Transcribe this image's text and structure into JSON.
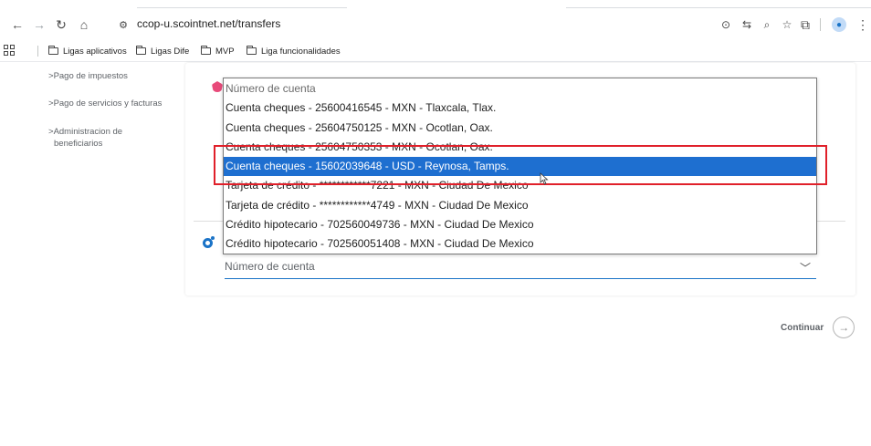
{
  "browser": {
    "url": "ccop-u.scointnet.net/transfers",
    "bookmarks": [
      "Ligas aplicativos",
      "Ligas Dife",
      "MVP",
      "Liga funcionalidades"
    ]
  },
  "sidebar": {
    "items": [
      "Pago de impuestos",
      "Pago de servicios y facturas",
      "Administracion de",
      "beneficiarios"
    ],
    "chevron": ">"
  },
  "dropdown": {
    "placeholder": "Número de cuenta",
    "options": [
      "Cuenta cheques - 25600416545 - MXN - Tlaxcala, Tlax.",
      "Cuenta cheques - 25604750125 - MXN - Ocotlan, Oax.",
      "Cuenta cheques - 25604750353 - MXN - Ocotlan, Oax.",
      "Cuenta cheques - 15602039648 - USD - Reynosa, Tamps.",
      "Tarjeta de crédito - ************7221 - MXN - Ciudad De Mexico",
      "Tarjeta de crédito - ************4749 - MXN - Ciudad De Mexico",
      "Crédito hipotecario - 702560049736 - MXN - Ciudad De Mexico",
      "Crédito hipotecario - 702560051408 - MXN - Ciudad De Mexico"
    ],
    "selected_index": 3
  },
  "destination_field": {
    "placeholder": "Número de cuenta"
  },
  "actions": {
    "continue_label": "Continuar"
  },
  "colors": {
    "selected": "#1e6fd0",
    "highlight": "#e0202a",
    "accent": "#1a73c7"
  }
}
